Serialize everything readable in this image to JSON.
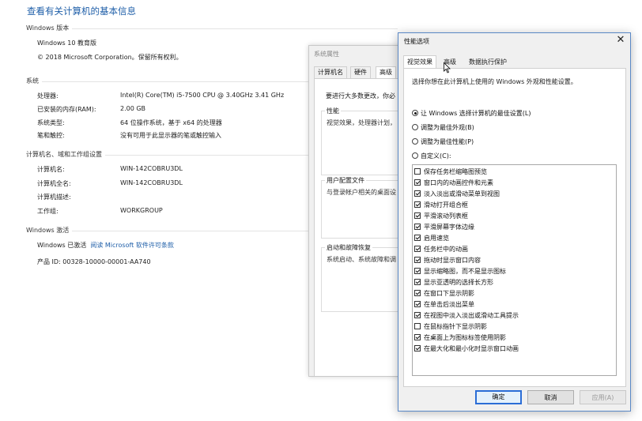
{
  "page": {
    "title": "查看有关计算机的基本信息",
    "sections": {
      "windows_edition": "Windows 版本",
      "system": "系统",
      "computer_name": "计算机名、域和工作组设置",
      "activation": "Windows 激活"
    },
    "edition": {
      "name": "Windows 10 教育版",
      "copyright": "© 2018 Microsoft Corporation。保留所有权利。"
    },
    "system": {
      "processor_label": "处理器:",
      "processor_value": "Intel(R) Core(TM) i5-7500 CPU @ 3.40GHz   3.41 GHz",
      "ram_label": "已安装的内存(RAM):",
      "ram_value": "2.00 GB",
      "type_label": "系统类型:",
      "type_value": "64 位操作系统，基于 x64 的处理器",
      "pen_label": "笔和触控:",
      "pen_value": "没有可用于此显示器的笔或触控输入"
    },
    "computer": {
      "name_label": "计算机名:",
      "name_value": "WIN-142COBRU3DL",
      "fullname_label": "计算机全名:",
      "fullname_value": "WIN-142COBRU3DL",
      "desc_label": "计算机描述:",
      "workgroup_label": "工作组:",
      "workgroup_value": "WORKGROUP"
    },
    "activation": {
      "status": "Windows 已激活",
      "license_link": "阅读 Microsoft 软件许可条款",
      "product_id": "产品 ID: 00328-10000-00001-AA740"
    }
  },
  "system_properties": {
    "title": "系统属性",
    "tabs": [
      "计算机名",
      "硬件",
      "高级"
    ],
    "admin_note": "要进行大多数更改，你必",
    "performance": {
      "label": "性能",
      "text": "视觉效果，处理器计划，"
    },
    "user_profiles": {
      "label": "用户配置文件",
      "text": "与登录帐户相关的桌面设"
    },
    "startup": {
      "label": "启动和故障恢复",
      "text": "系统启动、系统故障和调"
    }
  },
  "performance_options": {
    "title": "性能选项",
    "close_label": "✕",
    "tabs": [
      "视觉效果",
      "高级",
      "数据执行保护"
    ],
    "active_tab": 0,
    "description": "选择你想在此计算机上使用的 Windows 外观和性能设置。",
    "radios": [
      {
        "label": "让 Windows 选择计算机的最佳设置(L)",
        "checked": true
      },
      {
        "label": "调整为最佳外观(B)",
        "checked": false
      },
      {
        "label": "调整为最佳性能(P)",
        "checked": false
      },
      {
        "label": "自定义(C):",
        "checked": false
      }
    ],
    "effects": [
      {
        "label": "保存任务栏缩略图预览",
        "checked": false
      },
      {
        "label": "窗口内的动画控件和元素",
        "checked": true
      },
      {
        "label": "淡入淡出或滑动菜单到视图",
        "checked": true
      },
      {
        "label": "滑动打开组合框",
        "checked": true
      },
      {
        "label": "平滑滚动列表框",
        "checked": true
      },
      {
        "label": "平滑屏幕字体边缘",
        "checked": true
      },
      {
        "label": "启用速览",
        "checked": true
      },
      {
        "label": "任务栏中的动画",
        "checked": true
      },
      {
        "label": "拖动时显示窗口内容",
        "checked": true
      },
      {
        "label": "显示缩略图，而不是显示图标",
        "checked": true
      },
      {
        "label": "显示亚透明的选择长方形",
        "checked": true
      },
      {
        "label": "在窗口下显示阴影",
        "checked": true
      },
      {
        "label": "在单击后淡出菜单",
        "checked": true
      },
      {
        "label": "在视图中淡入淡出或滑动工具提示",
        "checked": true
      },
      {
        "label": "在鼠标指针下显示阴影",
        "checked": false
      },
      {
        "label": "在桌面上为图标标签使用阴影",
        "checked": true
      },
      {
        "label": "在最大化和最小化时显示窗口动画",
        "checked": true
      }
    ],
    "buttons": {
      "ok": "确定",
      "cancel": "取消",
      "apply": "应用(A)"
    }
  }
}
